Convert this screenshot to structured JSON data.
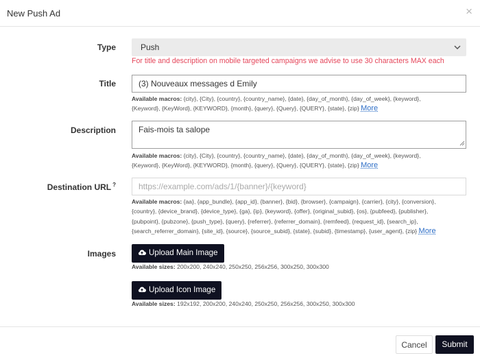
{
  "modal": {
    "title": "New Push Ad",
    "close": "×"
  },
  "type": {
    "label": "Type",
    "value": "Push",
    "chevron": "⌄",
    "warning": "For title and description on mobile targeted campaigns we advise to use 30 characters MAX each"
  },
  "title_field": {
    "label": "Title",
    "value": "(3) Nouveaux messages d Emily",
    "macros_label": "Available macros:",
    "macros_line1": "{city}, {City}, {country}, {country_name}, {date}, {day_of_month}, {day_of_week}, {keyword},",
    "macros_line2": "{Keyword}, {KeyWord}, {KEYWORD}, {month}, {query}, {Query}, {QUERY}, {state}, {zip}",
    "more": "More"
  },
  "description": {
    "label": "Description",
    "value": "Fais-mois ta salope",
    "macros_label": "Available macros:",
    "macros_line1": "{city}, {City}, {country}, {country_name}, {date}, {day_of_month}, {day_of_week}, {keyword},",
    "macros_line2": "{Keyword}, {KeyWord}, {KEYWORD}, {month}, {query}, {Query}, {QUERY}, {state}, {zip}",
    "more": "More"
  },
  "destination": {
    "label": "Destination URL",
    "sup": "?",
    "placeholder": "https://example.com/ads/1/{banner}/{keyword}",
    "macros_label": "Available macros:",
    "macros_line1": "{aa}, {app_bundle}, {app_id}, {banner}, {bid}, {browser}, {campaign}, {carrier}, {city}, {conversion},",
    "macros_line2": "{country}, {device_brand}, {device_type}, {ga}, {ip}, {keyword}, {offer}, {original_subid}, {os}, {pubfeed}, {publisher},",
    "macros_line3": "{pubpoint}, {pubzone}, {push_type}, {query}, {referrer}, {referrer_domain}, {remfeed}, {request_id}, {search_ip},",
    "macros_line4": "{search_referrer_domain}, {site_id}, {source}, {source_subid}, {state}, {subid}, {timestamp}, {user_agent}, {zip}",
    "more": "More"
  },
  "images": {
    "label": "Images",
    "main_button": "Upload Main Image",
    "main_sizes_label": "Available sizes:",
    "main_sizes": "200x200, 240x240, 250x250, 256x256, 300x250, 300x300",
    "icon_button": "Upload Icon Image",
    "icon_sizes_label": "Available sizes:",
    "icon_sizes": "192x192, 200x200, 240x240, 250x250, 256x256, 300x250, 300x300"
  },
  "footer": {
    "cancel": "Cancel",
    "submit": "Submit"
  },
  "colors": {
    "primary": "#0f1121",
    "warning": "#e5475b",
    "link": "#2f6fc7"
  }
}
